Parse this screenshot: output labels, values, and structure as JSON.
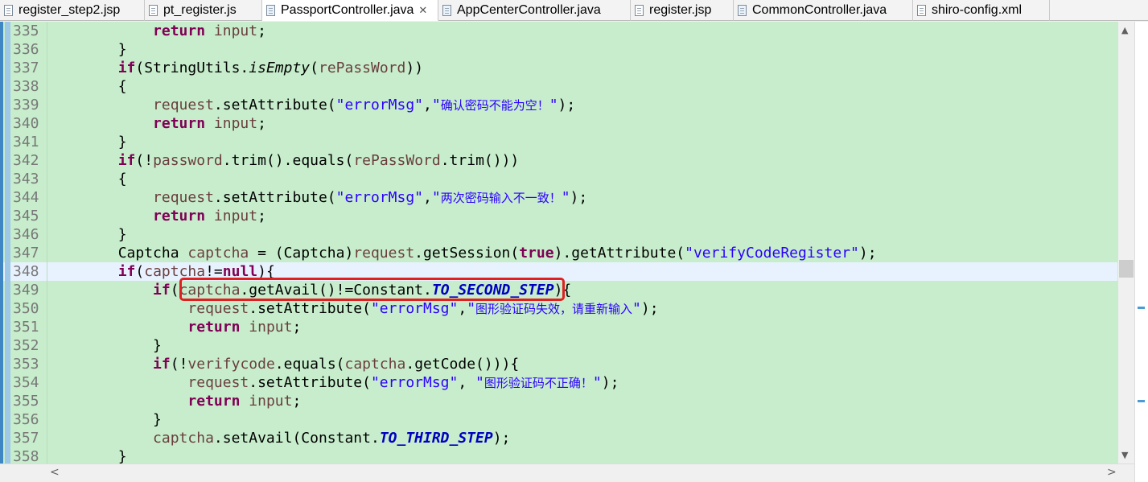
{
  "tabs": [
    {
      "label": "register_step2.jsp",
      "active": false
    },
    {
      "label": "pt_register.js",
      "active": false
    },
    {
      "label": "PassportController.java",
      "active": true,
      "close": "✕"
    },
    {
      "label": "AppCenterController.java",
      "active": false
    },
    {
      "label": "register.jsp",
      "active": false
    },
    {
      "label": "CommonController.java",
      "active": false
    },
    {
      "label": "shiro-config.xml",
      "active": false
    }
  ],
  "editor": {
    "current_line": "348",
    "highlighted_snippet": "captcha.getAvail()!=Constant.TO_SECOND_STEP",
    "lines": [
      {
        "n": "335",
        "segs": [
          [
            "pl",
            "            "
          ],
          [
            "kw",
            "return"
          ],
          [
            "pl",
            " "
          ],
          [
            "var",
            "input"
          ],
          [
            "pl",
            ";"
          ]
        ]
      },
      {
        "n": "336",
        "segs": [
          [
            "pl",
            "        }"
          ]
        ]
      },
      {
        "n": "337",
        "segs": [
          [
            "pl",
            "        "
          ],
          [
            "kw",
            "if"
          ],
          [
            "pl",
            "(StringUtils."
          ],
          [
            "it",
            "isEmpty"
          ],
          [
            "pl",
            "("
          ],
          [
            "var",
            "rePassWord"
          ],
          [
            "pl",
            "))"
          ]
        ]
      },
      {
        "n": "338",
        "segs": [
          [
            "pl",
            "        {"
          ]
        ]
      },
      {
        "n": "339",
        "segs": [
          [
            "pl",
            "            "
          ],
          [
            "var",
            "request"
          ],
          [
            "pl",
            ".setAttribute("
          ],
          [
            "str",
            "\"errorMsg\""
          ],
          [
            "pl",
            ","
          ],
          [
            "str",
            "\""
          ],
          [
            "strcjk",
            "确认密码不能为空！"
          ],
          [
            "str",
            "\""
          ],
          [
            "pl",
            ");"
          ]
        ]
      },
      {
        "n": "340",
        "segs": [
          [
            "pl",
            "            "
          ],
          [
            "kw",
            "return"
          ],
          [
            "pl",
            " "
          ],
          [
            "var",
            "input"
          ],
          [
            "pl",
            ";"
          ]
        ]
      },
      {
        "n": "341",
        "segs": [
          [
            "pl",
            "        }"
          ]
        ]
      },
      {
        "n": "342",
        "segs": [
          [
            "pl",
            "        "
          ],
          [
            "kw",
            "if"
          ],
          [
            "pl",
            "(!"
          ],
          [
            "var",
            "password"
          ],
          [
            "pl",
            ".trim().equals("
          ],
          [
            "var",
            "rePassWord"
          ],
          [
            "pl",
            ".trim()))"
          ]
        ]
      },
      {
        "n": "343",
        "segs": [
          [
            "pl",
            "        {"
          ]
        ]
      },
      {
        "n": "344",
        "segs": [
          [
            "pl",
            "            "
          ],
          [
            "var",
            "request"
          ],
          [
            "pl",
            ".setAttribute("
          ],
          [
            "str",
            "\"errorMsg\""
          ],
          [
            "pl",
            ","
          ],
          [
            "str",
            "\""
          ],
          [
            "strcjk",
            "两次密码输入不一致！"
          ],
          [
            "str",
            "\""
          ],
          [
            "pl",
            ");"
          ]
        ]
      },
      {
        "n": "345",
        "segs": [
          [
            "pl",
            "            "
          ],
          [
            "kw",
            "return"
          ],
          [
            "pl",
            " "
          ],
          [
            "var",
            "input"
          ],
          [
            "pl",
            ";"
          ]
        ]
      },
      {
        "n": "346",
        "segs": [
          [
            "pl",
            "        }"
          ]
        ]
      },
      {
        "n": "347",
        "segs": [
          [
            "pl",
            "        Captcha "
          ],
          [
            "var",
            "captcha"
          ],
          [
            "pl",
            " = (Captcha)"
          ],
          [
            "var",
            "request"
          ],
          [
            "pl",
            ".getSession("
          ],
          [
            "kw",
            "true"
          ],
          [
            "pl",
            ").getAttribute("
          ],
          [
            "str",
            "\"verifyCodeRegister\""
          ],
          [
            "pl",
            ");"
          ]
        ]
      },
      {
        "n": "348",
        "segs": [
          [
            "pl",
            "        "
          ],
          [
            "kw",
            "if"
          ],
          [
            "pl",
            "("
          ],
          [
            "var",
            "captcha"
          ],
          [
            "pl",
            "!="
          ],
          [
            "kw",
            "null"
          ],
          [
            "pl",
            "){"
          ]
        ]
      },
      {
        "n": "349",
        "segs": [
          [
            "pl",
            "            "
          ],
          [
            "kw",
            "if"
          ],
          [
            "pl",
            "("
          ],
          [
            "var",
            "captcha"
          ],
          [
            "pl",
            ".getAvail()!=Constant."
          ],
          [
            "fld",
            "TO_SECOND_STEP"
          ],
          [
            "pl",
            "){"
          ]
        ]
      },
      {
        "n": "350",
        "segs": [
          [
            "pl",
            "                "
          ],
          [
            "var",
            "request"
          ],
          [
            "pl",
            ".setAttribute("
          ],
          [
            "str",
            "\"errorMsg\""
          ],
          [
            "pl",
            ","
          ],
          [
            "str",
            "\""
          ],
          [
            "strcjk",
            "图形验证码失效，请重新输入"
          ],
          [
            "str",
            "\""
          ],
          [
            "pl",
            ");"
          ]
        ]
      },
      {
        "n": "351",
        "segs": [
          [
            "pl",
            "                "
          ],
          [
            "kw",
            "return"
          ],
          [
            "pl",
            " "
          ],
          [
            "var",
            "input"
          ],
          [
            "pl",
            ";"
          ]
        ]
      },
      {
        "n": "352",
        "segs": [
          [
            "pl",
            "            }"
          ]
        ]
      },
      {
        "n": "353",
        "segs": [
          [
            "pl",
            "            "
          ],
          [
            "kw",
            "if"
          ],
          [
            "pl",
            "(!"
          ],
          [
            "var",
            "verifycode"
          ],
          [
            "pl",
            ".equals("
          ],
          [
            "var",
            "captcha"
          ],
          [
            "pl",
            ".getCode())){"
          ]
        ]
      },
      {
        "n": "354",
        "segs": [
          [
            "pl",
            "                "
          ],
          [
            "var",
            "request"
          ],
          [
            "pl",
            ".setAttribute("
          ],
          [
            "str",
            "\"errorMsg\""
          ],
          [
            "pl",
            ", "
          ],
          [
            "str",
            "\""
          ],
          [
            "strcjk",
            "图形验证码不正确！"
          ],
          [
            "str",
            "\""
          ],
          [
            "pl",
            ");"
          ]
        ]
      },
      {
        "n": "355",
        "segs": [
          [
            "pl",
            "                "
          ],
          [
            "kw",
            "return"
          ],
          [
            "pl",
            " "
          ],
          [
            "var",
            "input"
          ],
          [
            "pl",
            ";"
          ]
        ]
      },
      {
        "n": "356",
        "segs": [
          [
            "pl",
            "            }"
          ]
        ]
      },
      {
        "n": "357",
        "segs": [
          [
            "pl",
            "            "
          ],
          [
            "var",
            "captcha"
          ],
          [
            "pl",
            ".setAvail(Constant."
          ],
          [
            "fld",
            "TO_THIRD_STEP"
          ],
          [
            "pl",
            ");"
          ]
        ]
      },
      {
        "n": "358",
        "segs": [
          [
            "pl",
            "        }"
          ]
        ]
      }
    ]
  },
  "scrollbars": {
    "up_arrow": "▲",
    "down_arrow": "▼",
    "left_arrow": "<",
    "right_arrow": ">"
  },
  "colors": {
    "editor_bg": "#c7edcc",
    "current_line_bg": "#e8f2fe",
    "keyword": "#7f0055",
    "string": "#2a00ff",
    "local_var": "#6a3e3e",
    "static_field": "#0000c0",
    "highlight_box": "#e02020"
  }
}
